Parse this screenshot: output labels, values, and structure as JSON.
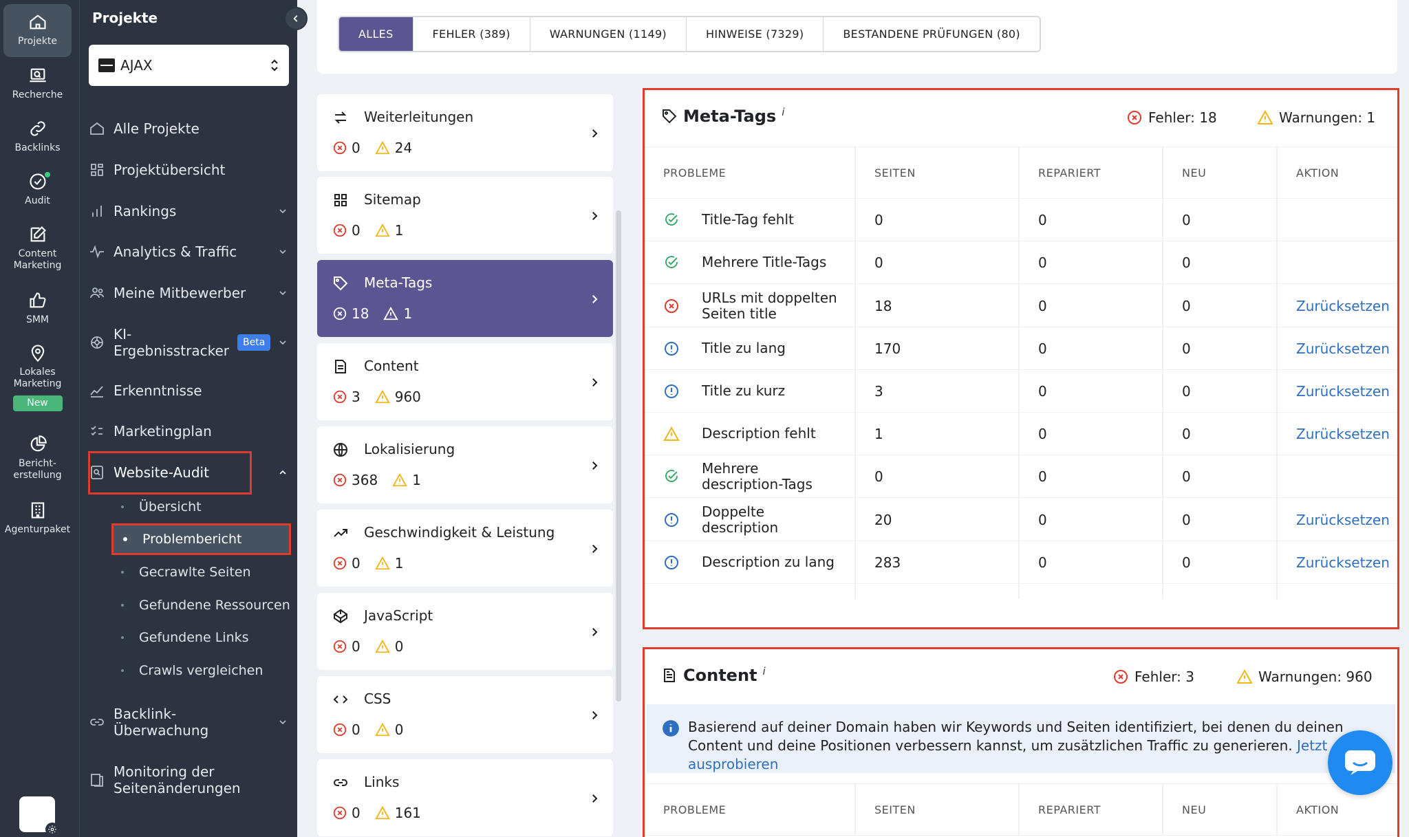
{
  "rail": {
    "items": [
      {
        "label": "Projekte",
        "icon": "home-icon"
      },
      {
        "label": "Recherche",
        "icon": "laptop-search-icon"
      },
      {
        "label": "Backlinks",
        "icon": "link-icon"
      },
      {
        "label": "Audit",
        "icon": "audit-check-icon"
      },
      {
        "label": "Content Marketing",
        "icon": "edit-icon"
      },
      {
        "label": "SMM",
        "icon": "thumbs-up-icon"
      },
      {
        "label": "Lokales Marketing",
        "icon": "map-pin-icon"
      },
      {
        "label": "Bericht-erstellung",
        "icon": "pie-chart-icon"
      },
      {
        "label": "Agenturpaket",
        "icon": "building-icon"
      }
    ],
    "new_badge": "New"
  },
  "sidebar": {
    "title": "Projekte",
    "project": "AJAX",
    "nav": [
      {
        "label": "Alle Projekte",
        "icon": "home-icon"
      },
      {
        "label": "Projektübersicht",
        "icon": "dashboard-icon"
      },
      {
        "label": "Rankings",
        "icon": "bar-chart-icon"
      },
      {
        "label": "Analytics & Traffic",
        "icon": "pulse-icon"
      },
      {
        "label": "Meine Mitbewerber",
        "icon": "users-icon"
      },
      {
        "label": "KI-\nErgebnisstracker",
        "icon": "ai-icon",
        "badge": "Beta"
      },
      {
        "label": "Erkenntnisse",
        "icon": "trend-icon"
      },
      {
        "label": "Marketingplan",
        "icon": "checklist-icon"
      },
      {
        "label": "Website-Audit",
        "icon": "audit-icon"
      },
      {
        "label": "Backlink-\nÜberwachung",
        "icon": "link-icon"
      },
      {
        "label": "Monitoring der\nSeitenänderungen",
        "icon": "pages-icon"
      }
    ],
    "sub": [
      "Übersicht",
      "Problembericht",
      "Gecrawlte Seiten",
      "Gefundene Ressourcen",
      "Gefundene Links",
      "Crawls vergleichen"
    ]
  },
  "tabs": [
    "ALLES",
    "FEHLER (389)",
    "WARNUNGEN (1149)",
    "HINWEISE (7329)",
    "BESTANDENE PRÜFUNGEN (80)"
  ],
  "categories": [
    {
      "name": "Weiterleitungen",
      "errors": "0",
      "warnings": "24",
      "icon": "redirect-icon"
    },
    {
      "name": "Sitemap",
      "errors": "0",
      "warnings": "1",
      "icon": "sitemap-icon"
    },
    {
      "name": "Meta-Tags",
      "errors": "18",
      "warnings": "1",
      "icon": "tag-icon"
    },
    {
      "name": "Content",
      "errors": "3",
      "warnings": "960",
      "icon": "document-icon"
    },
    {
      "name": "Lokalisierung",
      "errors": "368",
      "warnings": "1",
      "icon": "globe-icon"
    },
    {
      "name": "Geschwindigkeit & Leistung",
      "errors": "0",
      "warnings": "1",
      "icon": "speed-icon"
    },
    {
      "name": "JavaScript",
      "errors": "0",
      "warnings": "0",
      "icon": "codepen-icon"
    },
    {
      "name": "CSS",
      "errors": "0",
      "warnings": "0",
      "icon": "code-icon"
    },
    {
      "name": "Links",
      "errors": "0",
      "warnings": "161",
      "icon": "link-icon"
    }
  ],
  "meta_panel": {
    "title": "Meta-Tags",
    "info_mark": "i",
    "errors_label": "Fehler: 18",
    "warnings_label": "Warnungen: 1",
    "columns": [
      "PROBLEME",
      "SEITEN",
      "REPARIERT",
      "NEU",
      "AKTION"
    ],
    "rows": [
      {
        "status": "ok",
        "problem": "Title-Tag fehlt",
        "pages": "0",
        "fixed": "0",
        "new": "0",
        "action": ""
      },
      {
        "status": "ok",
        "problem": "Mehrere Title-Tags",
        "pages": "0",
        "fixed": "0",
        "new": "0",
        "action": ""
      },
      {
        "status": "error",
        "problem": "URLs mit doppelten Seiten title",
        "pages": "18",
        "fixed": "0",
        "new": "0",
        "action": "Zurücksetzen"
      },
      {
        "status": "notice",
        "problem": "Title zu lang",
        "pages": "170",
        "fixed": "0",
        "new": "0",
        "action": "Zurücksetzen"
      },
      {
        "status": "notice",
        "problem": "Title zu kurz",
        "pages": "3",
        "fixed": "0",
        "new": "0",
        "action": "Zurücksetzen"
      },
      {
        "status": "warning",
        "problem": "Description fehlt",
        "pages": "1",
        "fixed": "0",
        "new": "0",
        "action": "Zurücksetzen"
      },
      {
        "status": "ok",
        "problem": "Mehrere description-Tags",
        "pages": "0",
        "fixed": "0",
        "new": "0",
        "action": ""
      },
      {
        "status": "notice",
        "problem": "Doppelte description",
        "pages": "20",
        "fixed": "0",
        "new": "0",
        "action": "Zurücksetzen"
      },
      {
        "status": "notice",
        "problem": "Description zu lang",
        "pages": "283",
        "fixed": "0",
        "new": "0",
        "action": "Zurücksetzen"
      }
    ]
  },
  "content_panel": {
    "title": "Content",
    "info_mark": "i",
    "errors_label": "Fehler: 3",
    "warnings_label": "Warnungen: 960",
    "info_text": "Basierend auf deiner Domain haben wir Keywords und Seiten identifiziert, bei denen du deinen Content und deine Positionen verbessern kannst, um zusätzlichen Traffic zu generieren.",
    "info_link": "Jetzt ausprobieren",
    "columns": [
      "PROBLEME",
      "SEITEN",
      "REPARIERT",
      "NEU",
      "AKTION"
    ]
  },
  "colors": {
    "accent": "#5b5591",
    "error": "#e03b2f",
    "warning": "#f2b51a",
    "ok": "#3aab6d",
    "notice": "#2f6fc1",
    "sidebar": "#2b3440"
  }
}
